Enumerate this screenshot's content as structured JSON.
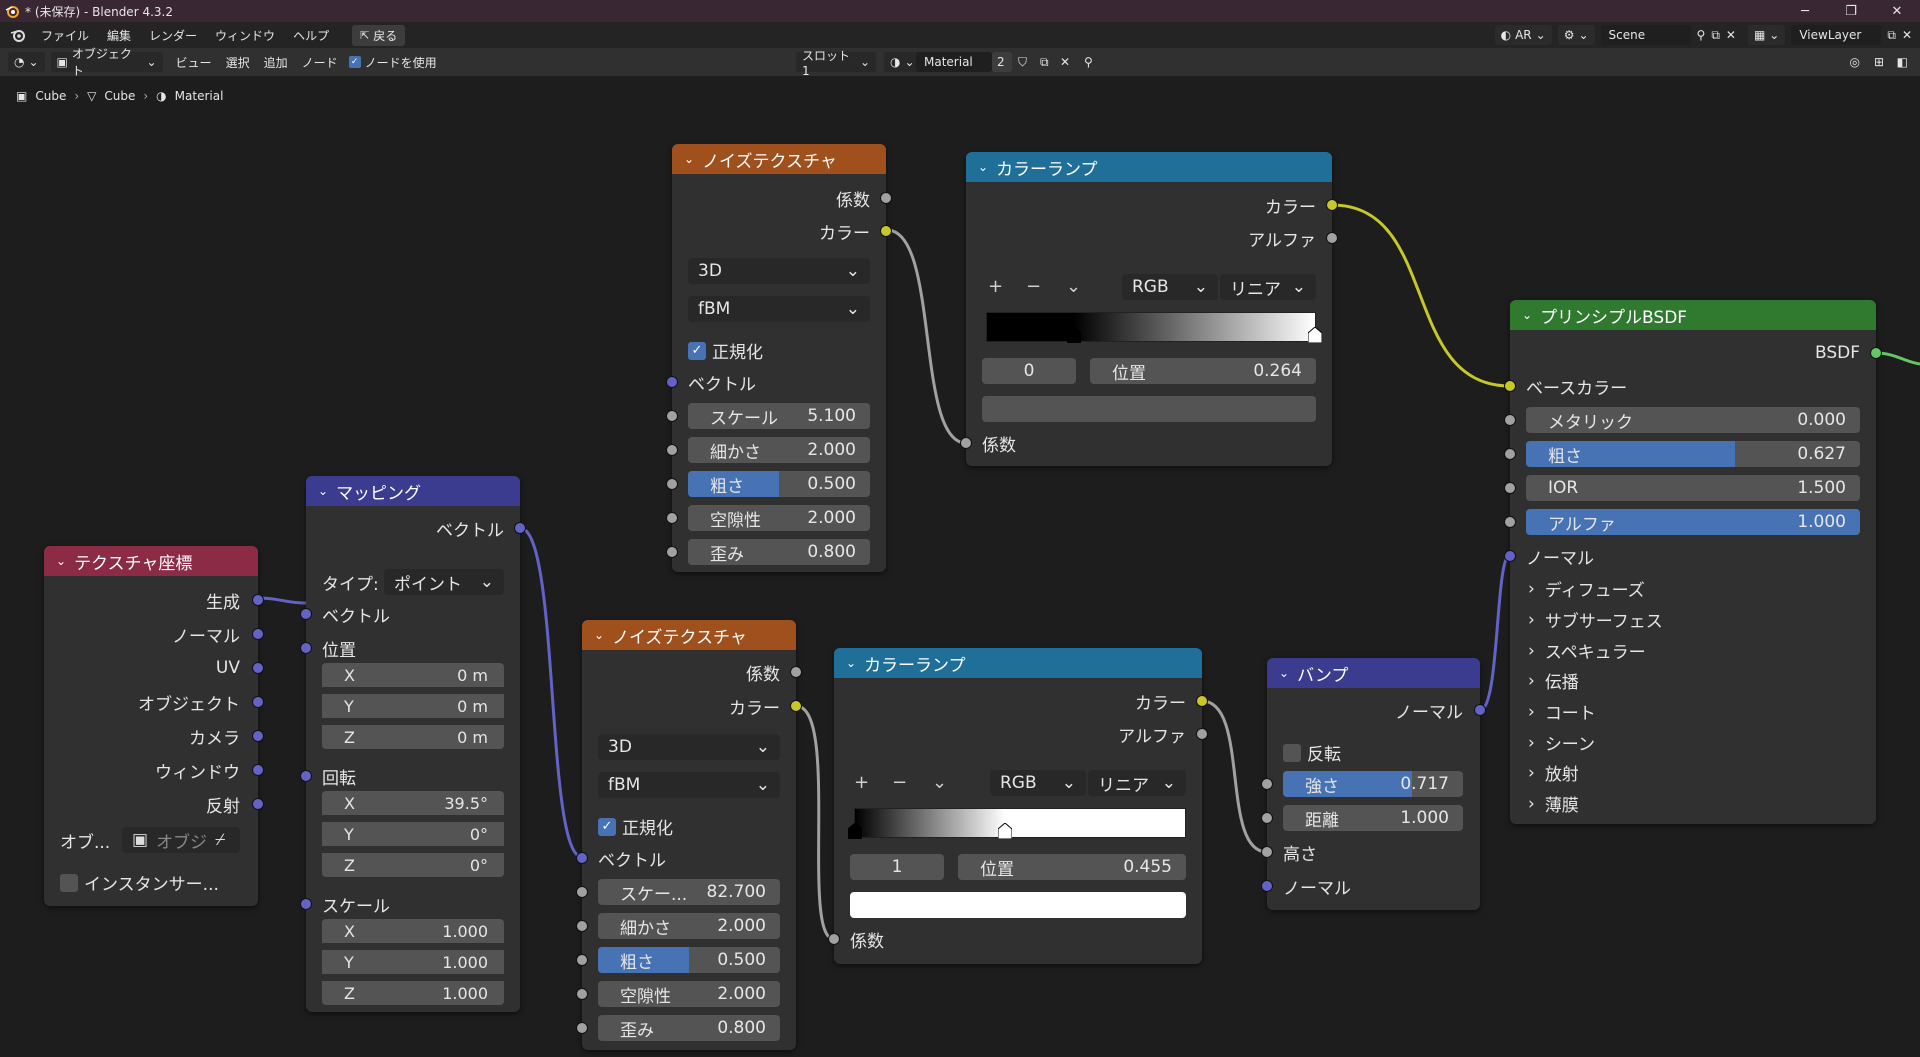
{
  "window": {
    "title": "* (未保存) - Blender 4.3.2",
    "controls": [
      "─",
      "❐",
      "✕"
    ]
  },
  "menu": {
    "items": [
      "ファイル",
      "編集",
      "レンダー",
      "ウィンドウ",
      "ヘルプ"
    ],
    "back_label": "戻る",
    "ar_label": "AR",
    "scene_label": "Scene",
    "viewlayer_label": "ViewLayer"
  },
  "editor_header": {
    "mode_label": "オブジェクト",
    "view_label": "ビュー",
    "select_label": "選択",
    "add_label": "追加",
    "node_label": "ノード",
    "use_nodes_label": "ノードを使用",
    "slot_label": "スロット1",
    "material_name": "Material",
    "material_users": "2"
  },
  "breadcrumb": [
    "Cube",
    "Cube",
    "Material"
  ],
  "nodes": {
    "texcoord": {
      "title": "テクスチャ座標",
      "outputs": [
        "生成",
        "ノーマル",
        "UV",
        "オブジェクト",
        "カメラ",
        "ウィンドウ",
        "反射"
      ],
      "object_label": "オブ...",
      "object_placeholder": "オブジ",
      "instancer_label": "インスタンサー..."
    },
    "mapping": {
      "title": "マッピング",
      "output": "ベクトル",
      "type_label": "タイプ:",
      "type_value": "ポイント",
      "vector_label": "ベクトル",
      "location_label": "位置",
      "location": [
        [
          "X",
          "0 m"
        ],
        [
          "Y",
          "0 m"
        ],
        [
          "Z",
          "0 m"
        ]
      ],
      "rotation_label": "回転",
      "rotation": [
        [
          "X",
          "39.5°"
        ],
        [
          "Y",
          "0°"
        ],
        [
          "Z",
          "0°"
        ]
      ],
      "scale_label": "スケール",
      "scale": [
        [
          "X",
          "1.000"
        ],
        [
          "Y",
          "1.000"
        ],
        [
          "Z",
          "1.000"
        ]
      ]
    },
    "noise1": {
      "title": "ノイズテクスチャ",
      "out_fac": "係数",
      "out_color": "カラー",
      "dim": "3D",
      "type": "fBM",
      "normalize": "正規化",
      "vector": "ベクトル",
      "fields": [
        [
          "スケール",
          "5.100"
        ],
        [
          "細かさ",
          "2.000"
        ],
        [
          "粗さ",
          "0.500"
        ],
        [
          "空隙性",
          "2.000"
        ],
        [
          "歪み",
          "0.800"
        ]
      ],
      "roughness_fill": 0.5
    },
    "noise2": {
      "title": "ノイズテクスチャ",
      "out_fac": "係数",
      "out_color": "カラー",
      "dim": "3D",
      "type": "fBM",
      "normalize": "正規化",
      "vector": "ベクトル",
      "fields": [
        [
          "スケー...",
          "82.700"
        ],
        [
          "細かさ",
          "2.000"
        ],
        [
          "粗さ",
          "0.500"
        ],
        [
          "空隙性",
          "2.000"
        ],
        [
          "歪み",
          "0.800"
        ]
      ],
      "roughness_fill": 0.5
    },
    "ramp1": {
      "title": "カラーランプ",
      "out_color": "カラー",
      "out_alpha": "アルファ",
      "mode": "RGB",
      "interp": "リニア",
      "index": "0",
      "pos_label": "位置",
      "pos_value": "0.264",
      "input": "係数",
      "stops": [
        0.264,
        1.0
      ]
    },
    "ramp2": {
      "title": "カラーランプ",
      "out_color": "カラー",
      "out_alpha": "アルファ",
      "mode": "RGB",
      "interp": "リニア",
      "index": "1",
      "pos_label": "位置",
      "pos_value": "0.455",
      "input": "係数",
      "stops": [
        0.0,
        0.455
      ]
    },
    "bump": {
      "title": "バンプ",
      "output": "ノーマル",
      "invert": "反転",
      "strength_label": "強さ",
      "strength": "0.717",
      "strength_fill": 0.717,
      "distance_label": "距離",
      "distance": "1.000",
      "height": "高さ",
      "normal": "ノーマル"
    },
    "bsdf": {
      "title": "プリンシプルBSDF",
      "output": "BSDF",
      "base_color": "ベースカラー",
      "fields": [
        [
          "メタリック",
          "0.000"
        ],
        [
          "粗さ",
          "0.627"
        ],
        [
          "IOR",
          "1.500"
        ],
        [
          "アルファ",
          "1.000"
        ]
      ],
      "fills": [
        0,
        0.627,
        0,
        1.0
      ],
      "normal": "ノーマル",
      "panels": [
        "ディフューズ",
        "サブサーフェス",
        "スペキュラー",
        "伝播",
        "コート",
        "シーン",
        "放射",
        "薄膜"
      ]
    }
  },
  "colors": {
    "titlebar": "#3a2734",
    "header_texcoord": "#8b2b45",
    "header_mapping": "#3b3b8f",
    "header_noise": "#a0501c",
    "header_ramp": "#1f6f99",
    "header_bump": "#3b3b8f",
    "header_bsdf": "#2f7a2f",
    "wire_yellow": "#c7c729",
    "wire_grey": "#a1a1a1",
    "wire_blue": "#6363c7",
    "accent": "#4772b3"
  }
}
